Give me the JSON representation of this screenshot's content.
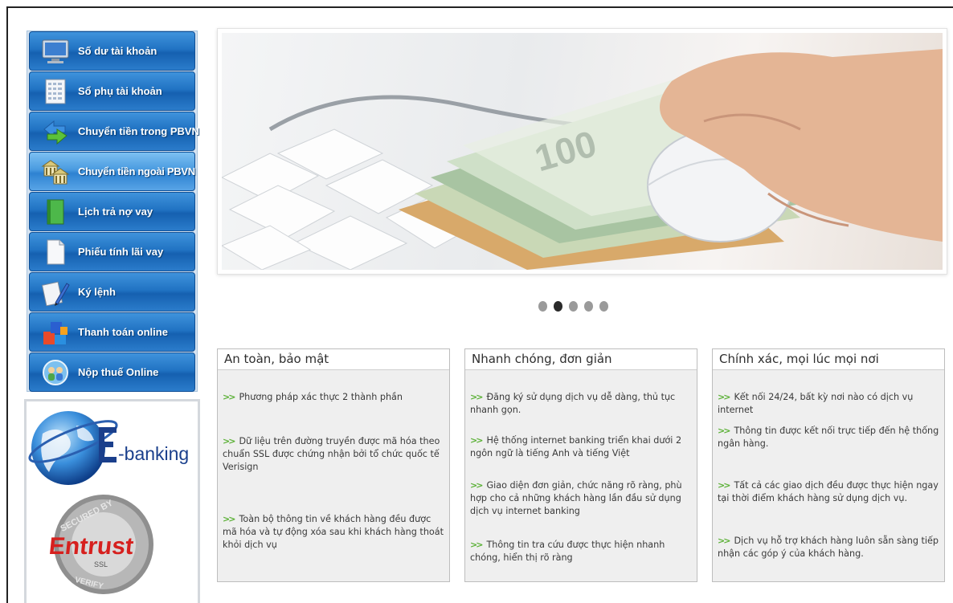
{
  "sidebar": {
    "items": [
      {
        "label": "Số dư tài khoản",
        "icon": "monitor-icon"
      },
      {
        "label": "Sổ phụ tài khoản",
        "icon": "ledger-icon"
      },
      {
        "label": "Chuyển tiền trong PBVN",
        "icon": "transfer-arrows-icon"
      },
      {
        "label": "Chuyển tiền ngoài PBVN",
        "icon": "bank-transfer-icon"
      },
      {
        "label": "Lịch trả nợ vay",
        "icon": "book-icon"
      },
      {
        "label": "Phiếu tính lãi vay",
        "icon": "document-icon"
      },
      {
        "label": "Ký lệnh",
        "icon": "signature-pen-icon"
      },
      {
        "label": "Thanh toán online",
        "icon": "blocks-icon"
      },
      {
        "label": "Nộp thuế Online",
        "icon": "globe-people-icon"
      }
    ]
  },
  "logos": {
    "ebanking": "E-banking",
    "entrust_seal": "SECURED BY Entrust SSL VERIFY"
  },
  "banner": {
    "banknote_text": "100",
    "slide_count": 5,
    "active_slide": 2
  },
  "columns": [
    {
      "title": "An toàn, bảo mật",
      "points": [
        "Phương pháp xác thực 2 thành phần",
        "Dữ liệu trên đường truyền được mã hóa theo chuẩn SSL được chứng nhận bởi tổ chức quốc tế Verisign",
        "Toàn bộ thông tin về khách hàng đều được mã hóa và tự động xóa sau khi khách hàng thoát khỏi dịch vụ"
      ]
    },
    {
      "title": "Nhanh chóng, đơn giản",
      "points": [
        "Đăng ký sử dụng dịch vụ dễ dàng, thủ tục nhanh gọn.",
        "Hệ thống internet banking triển khai dưới 2 ngôn ngữ là tiếng Anh và tiếng Việt",
        "Giao diện đơn giản, chức năng rõ ràng, phù hợp cho cả những khách hàng lần đầu sử dụng dịch vụ internet banking",
        "Thông tin tra cứu được thực hiện nhanh chóng, hiển thị rõ ràng"
      ]
    },
    {
      "title": "Chính xác, mọi lúc mọi nơi",
      "points": [
        "Kết nối 24/24, bất kỳ nơi nào có dịch vụ internet",
        "Thông tin được kết nối trực tiếp đến hệ thống ngân hàng.",
        "Tất cả các giao dịch đều được thực hiện ngay tại thời điểm khách hàng sử dụng dịch vụ.",
        "Dịch vụ hỗ trợ khách hàng luôn sẵn sàng tiếp nhận các góp ý của khách hàng."
      ]
    }
  ],
  "colors": {
    "nav_blue": "#2173c3",
    "nav_active": "#4a9be0",
    "bullet_green": "#5ab035"
  }
}
